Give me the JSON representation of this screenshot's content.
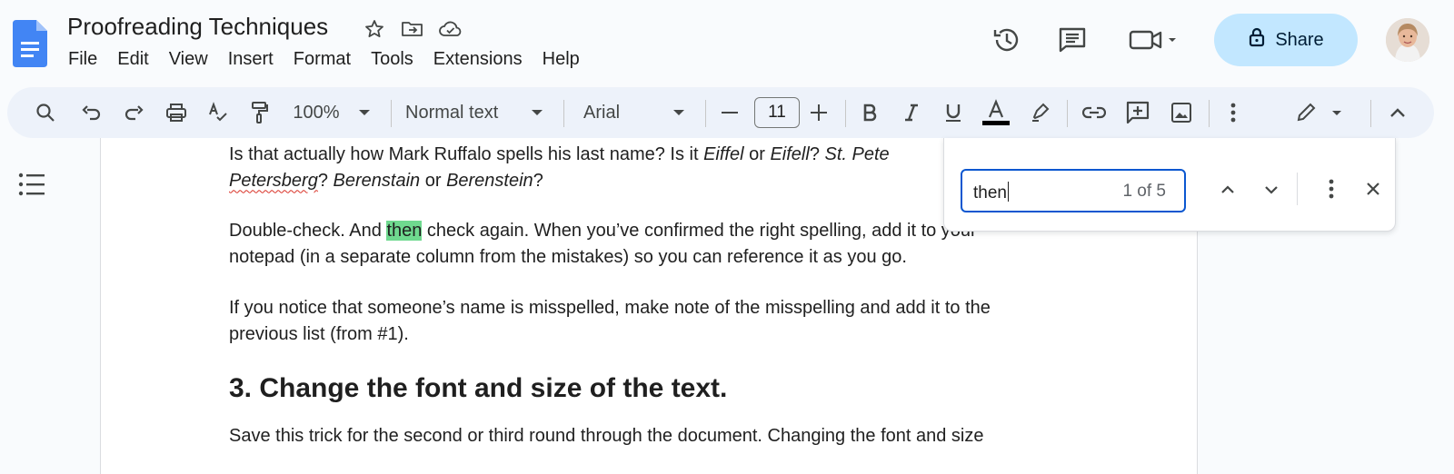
{
  "header": {
    "title": "Proofreading Techniques",
    "menu": [
      "File",
      "Edit",
      "View",
      "Insert",
      "Format",
      "Tools",
      "Extensions",
      "Help"
    ],
    "share_label": "Share"
  },
  "toolbar": {
    "zoom": "100%",
    "style": "Normal text",
    "font": "Arial",
    "font_size": "11"
  },
  "document": {
    "p1_line1": "Is that actually how Mark Ruffalo spells his last name? Is it ",
    "p1_eiffel": "Eiffel",
    "p1_or1": " or ",
    "p1_eifell": "Eifell",
    "p1_q1": "? ",
    "p1_stpete": "St. Pete",
    "p1_petersberg": "Petersberg",
    "p1_q2": "? ",
    "p1_berenstain": "Berenstain",
    "p1_or2": " or ",
    "p1_berenstein": "Berenstein",
    "p1_q3": "?",
    "p2_a": "Double-check. And ",
    "p2_hl": "then",
    "p2_b": " check again. When you’ve confirmed the right spelling, add it to your",
    "p2_c": "notepad (in a separate column from the mistakes) so you can reference it as you go.",
    "p3_a": "If you notice that someone’s name is misspelled, make note of the misspelling and add it to the",
    "p3_b": "previous list (from #1).",
    "heading": "3. Change the font and size of the text.",
    "p4_a": "Save this trick for the second or third round through the document. Changing the font and size"
  },
  "find": {
    "query": "then",
    "count": "1 of 5"
  },
  "colors": {
    "accent": "#0b57d0",
    "share_bg": "#c2e7ff",
    "highlight": "#6fd98f",
    "toolbar_bg": "#edf2fa",
    "docs_blue": "#4285f4"
  },
  "icons": [
    "docs-logo-icon",
    "star-icon",
    "move-folder-icon",
    "cloud-saved-icon",
    "history-icon",
    "comments-icon",
    "meet-icon",
    "lock-icon",
    "search-icon",
    "undo-icon",
    "redo-icon",
    "print-icon",
    "spellcheck-icon",
    "paint-format-icon",
    "bold-icon",
    "italic-icon",
    "underline-icon",
    "text-color-icon",
    "highlight-icon",
    "link-icon",
    "add-comment-icon",
    "insert-image-icon",
    "more-icon",
    "edit-mode-icon",
    "collapse-icon",
    "outline-icon",
    "previous-icon",
    "next-icon",
    "close-icon"
  ]
}
